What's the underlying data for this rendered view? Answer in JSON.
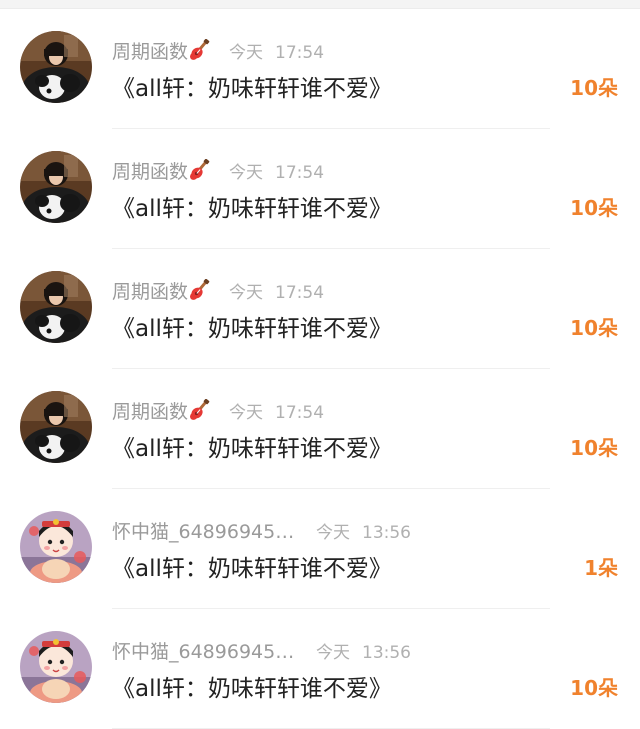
{
  "rows": [
    {
      "nickname": "周期函数",
      "avatar": "avatar-girl-dog",
      "badge": "guitar-icon",
      "day": "今天",
      "time": "17:54",
      "title": "《all轩：奶味轩轩谁不爱》",
      "gift": "10朵"
    },
    {
      "nickname": "周期函数",
      "avatar": "avatar-girl-dog",
      "badge": "guitar-icon",
      "day": "今天",
      "time": "17:54",
      "title": "《all轩：奶味轩轩谁不爱》",
      "gift": "10朵"
    },
    {
      "nickname": "周期函数",
      "avatar": "avatar-girl-dog",
      "badge": "guitar-icon",
      "day": "今天",
      "time": "17:54",
      "title": "《all轩：奶味轩轩谁不爱》",
      "gift": "10朵"
    },
    {
      "nickname": "周期函数",
      "avatar": "avatar-girl-dog",
      "badge": "guitar-icon",
      "day": "今天",
      "time": "17:54",
      "title": "《all轩：奶味轩轩谁不爱》",
      "gift": "10朵"
    },
    {
      "nickname": "怀中猫_648969456…",
      "avatar": "avatar-doll",
      "badge": "",
      "day": "今天",
      "time": "13:56",
      "title": "《all轩：奶味轩轩谁不爱》",
      "gift": "1朵"
    },
    {
      "nickname": "怀中猫_648969456…",
      "avatar": "avatar-doll",
      "badge": "",
      "day": "今天",
      "time": "13:56",
      "title": "《all轩：奶味轩轩谁不爱》",
      "gift": "10朵"
    }
  ],
  "colors": {
    "gift": "#f0822d",
    "nickname": "#9a9a9a",
    "time": "#b0b0b0",
    "title": "#222222"
  }
}
